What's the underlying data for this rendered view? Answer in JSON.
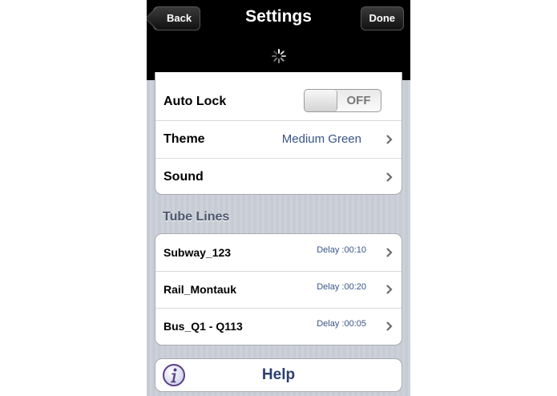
{
  "nav": {
    "title": "Settings",
    "back_label": "Back",
    "done_label": "Done"
  },
  "settings": {
    "auto_lock": {
      "label": "Auto Lock",
      "toggle_text": "OFF"
    },
    "theme": {
      "label": "Theme",
      "value": "Medium Green"
    },
    "sound": {
      "label": "Sound"
    }
  },
  "tube_lines": {
    "header": "Tube Lines",
    "items": [
      {
        "name": "Subway_123",
        "delay": "Delay :00:10"
      },
      {
        "name": "Rail_Montauk",
        "delay": "Delay :00:20"
      },
      {
        "name": "Bus_Q1 - Q113",
        "delay": "Delay :00:05"
      }
    ]
  },
  "help": {
    "label": "Help"
  },
  "icons": {
    "spinner": "activity-spinner-icon",
    "chevron": "chevron-right-icon",
    "info": "info-icon"
  },
  "colors": {
    "navbar": "#000000",
    "value_text": "#385487",
    "section_header": "#4c566c",
    "help_text": "#2b3f6e",
    "info_icon": "#5a3d8a"
  }
}
